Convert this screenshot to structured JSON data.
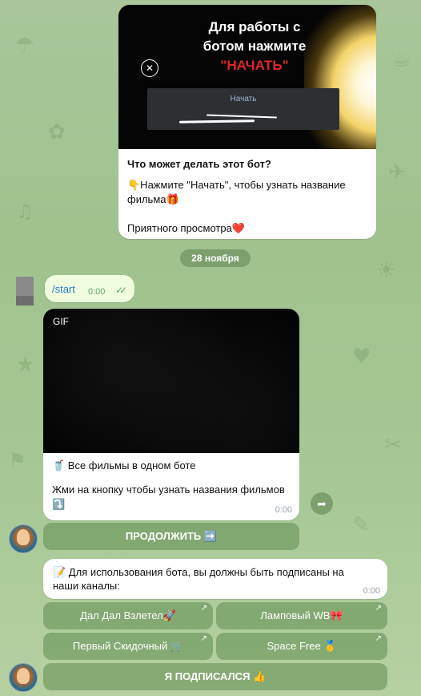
{
  "intro_message": {
    "image_title_line1": "Для работы с",
    "image_title_line2": "ботом нажмите",
    "image_title_accent": "\"НАЧАТЬ\"",
    "image_button_label": "Начать",
    "heading": "Что может делать этот бот?",
    "body_line": "👇Нажмите \"Начать\", чтобы узнать название фильма🎁",
    "footer_line": "Приятного просмотра❤️"
  },
  "date_chip": "28 ноября",
  "start_message": {
    "text": "/start",
    "time": "0:00",
    "status": "read"
  },
  "gif_message": {
    "badge": "GIF",
    "line1": "🥤 Все фильмы в одном боте",
    "line2": "Жми на кнопку чтобы узнать названия фильмов ⤵️",
    "time": "0:00"
  },
  "buttons": {
    "continue": "ПРОДОЛЖИТЬ ➡️",
    "channel1": "Дал Дал Взлетел🚀",
    "channel2": "Ламповый WB🎀",
    "channel3": "Первый Скидочный 🛒",
    "channel4": "Space Free 🥇",
    "subscribed": "Я ПОДПИСАЛСЯ 👍",
    "link_arrow": "↗"
  },
  "subscribe_message": {
    "text": "📝 Для использования бота, вы должны быть подписаны на наши каналы:",
    "time": "0:00"
  },
  "icons": {
    "forward": "forward-icon",
    "read_ticks": "double-check-icon"
  },
  "colors": {
    "accent_link": "#2a7ad1",
    "outgoing_bubble": "#effdde",
    "keyboard_button": "#6f9a5e",
    "title_accent": "#e02626"
  }
}
